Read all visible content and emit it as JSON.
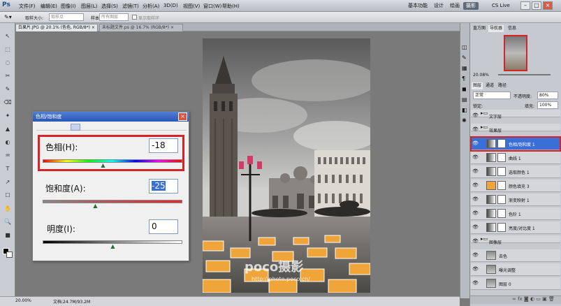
{
  "app": {
    "logo": "Ps"
  },
  "menu": [
    "文件(F)",
    "编辑(E)",
    "图像(I)",
    "图层(L)",
    "选择(S)",
    "滤镜(T)",
    "分析(A)",
    "3D(D)",
    "视图(V)",
    "窗口(W)",
    "帮助(H)"
  ],
  "workspaces": {
    "items": [
      "基本功能",
      "设计",
      "绘画",
      "摄影"
    ],
    "active": "摄影",
    "cslive": "CS Live"
  },
  "options": {
    "sample_label": "取样大小:",
    "sample_value": "取样点",
    "sample2": "所有图层",
    "show_ring": "显示取样环"
  },
  "tabs": [
    {
      "label": "白果片.JPG @ 20.1% (色色, RGB/8*) ×",
      "active": true
    },
    {
      "label": "未标题文件.ps @ 16.7% (RGB/8*) ×",
      "active": false
    }
  ],
  "status": {
    "zoom": "20.00%",
    "doc": "文档:24.7M/93.2M"
  },
  "dialog": {
    "title": "色相/饱和度",
    "hue_label": "色相(H):",
    "hue_value": "-18",
    "hue_fraction": 0.43,
    "sat_label": "饱和度(A):",
    "sat_value": "-25",
    "sat_fraction": 0.375,
    "light_label": "明度(I):",
    "light_value": "0",
    "light_fraction": 0.5
  },
  "navigator": {
    "tabs": [
      "直方图",
      "导航器",
      "信息"
    ],
    "active": "导航器",
    "zoom": "20.08%"
  },
  "layers_panel": {
    "tabs": [
      "图层",
      "通道",
      "路径"
    ],
    "blend_mode": "正常",
    "opacity_label": "不透明度:",
    "opacity": "80%",
    "lock_label": "锁定:",
    "fill_label": "填充:",
    "fill": "100%",
    "layers": [
      {
        "name": "文字层",
        "kind": "group",
        "selected": false
      },
      {
        "name": "效果层",
        "kind": "group",
        "selected": false
      },
      {
        "name": "色相/饱和度 1",
        "kind": "adjust",
        "selected": true
      },
      {
        "name": "曲线 1",
        "kind": "adjust",
        "selected": false
      },
      {
        "name": "选取颜色 1",
        "kind": "adjust",
        "selected": false
      },
      {
        "name": "颜色填充 3",
        "kind": "fill",
        "selected": false
      },
      {
        "name": "渐变映射 1",
        "kind": "adjust",
        "selected": false
      },
      {
        "name": "色阶 1",
        "kind": "adjust",
        "selected": false
      },
      {
        "name": "亮度/对比度 1",
        "kind": "adjust",
        "selected": false
      },
      {
        "name": "图像层",
        "kind": "group",
        "selected": false
      },
      {
        "name": "去色",
        "kind": "image",
        "selected": false
      },
      {
        "name": "曝光调整",
        "kind": "image",
        "selected": false
      },
      {
        "name": "图层 0",
        "kind": "image",
        "selected": false
      }
    ]
  },
  "watermark": "poco摄影",
  "watermark_url": "http://photo.poco.cn/",
  "colors": {
    "highlight": "#d52329",
    "selection": "#3b6fd8",
    "fill_orange": "#f0a53a"
  }
}
